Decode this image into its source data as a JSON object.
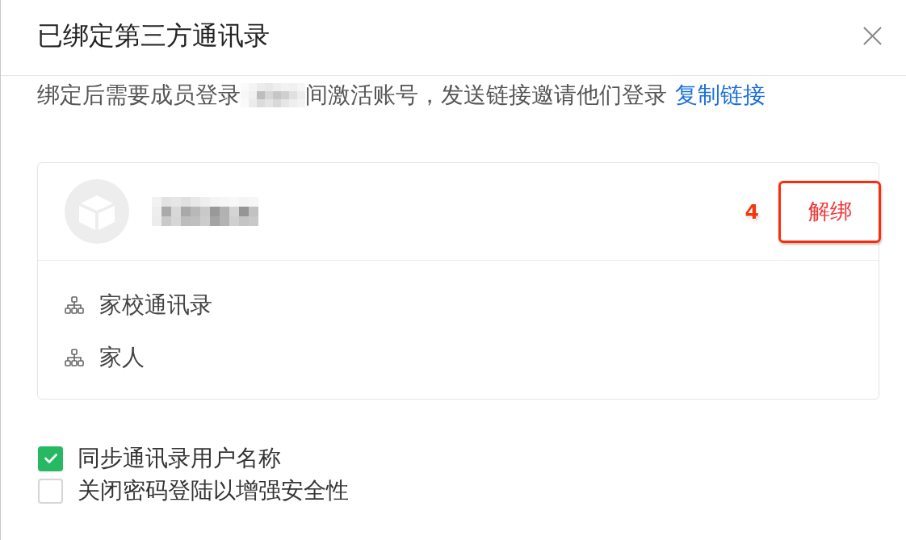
{
  "dialog": {
    "title": "已绑定第三方通讯录"
  },
  "notice": [
    {
      "kind": "text",
      "text": "绑定后需要成员登录"
    },
    {
      "kind": "redacted"
    },
    {
      "kind": "text",
      "text": "间激活账号，发送链接邀请他们登录"
    },
    {
      "kind": "link",
      "text": "复制链接"
    }
  ],
  "directory": {
    "step_marker": "4",
    "unbind_button": {
      "label": "解绑",
      "highlighted": true
    },
    "groups": [
      {
        "label": "家校通讯录"
      },
      {
        "label": "家人"
      }
    ]
  },
  "options": [
    {
      "label": "同步通讯录用户名称",
      "checked": true
    },
    {
      "label": "关闭密码登陆以增强安全性",
      "checked": false
    }
  ]
}
